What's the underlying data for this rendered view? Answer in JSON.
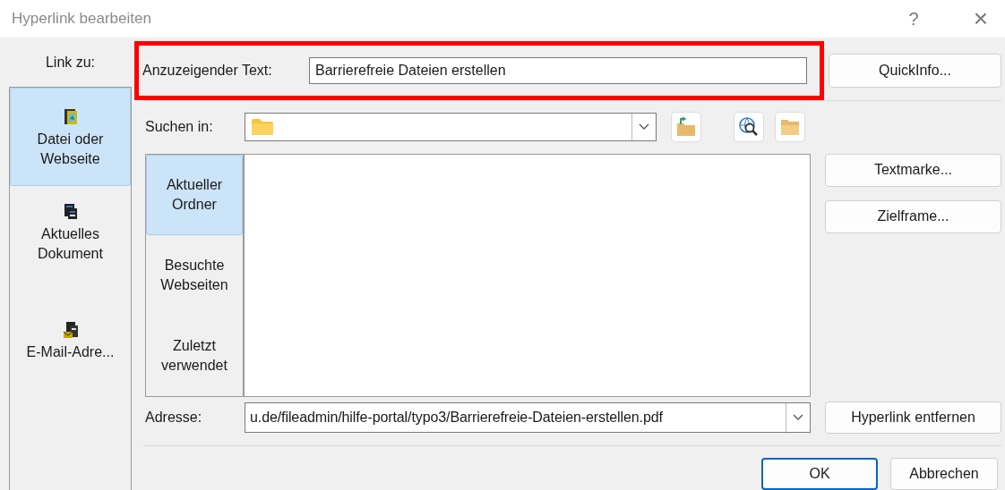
{
  "window": {
    "title": "Hyperlink bearbeiten",
    "help": "?",
    "close": "×"
  },
  "link_to": {
    "label": "Link zu:",
    "items": [
      {
        "label": "Datei oder Webseite",
        "kind": "file",
        "selected": true
      },
      {
        "label": "Aktuelles Dokument",
        "kind": "document",
        "selected": false
      },
      {
        "label": "E-Mail-Adre...",
        "kind": "email",
        "selected": false
      }
    ]
  },
  "display_text": {
    "label": "Anzuzeigender Text:",
    "value": "Barrierefreie Dateien erstellen",
    "highlighted": true
  },
  "screentip_button": "QuickInfo...",
  "look_in": {
    "label": "Suchen in:"
  },
  "browse": {
    "items": [
      {
        "label": "Aktueller Ordner",
        "selected": true
      },
      {
        "label": "Besuchte Webseiten",
        "selected": false
      },
      {
        "label": "Zuletzt verwendet",
        "selected": false
      }
    ]
  },
  "side_buttons": [
    "Textmarke...",
    "Zielframe..."
  ],
  "address": {
    "label": "Adresse:",
    "value": "u.de/fileadmin/hilfe-portal/typo3/Barrierefreie-Dateien-erstellen.pdf"
  },
  "remove_button": "Hyperlink entfernen",
  "buttons": [
    {
      "label": "OK",
      "default": true
    },
    {
      "label": "Abbrechen",
      "default": false
    }
  ]
}
